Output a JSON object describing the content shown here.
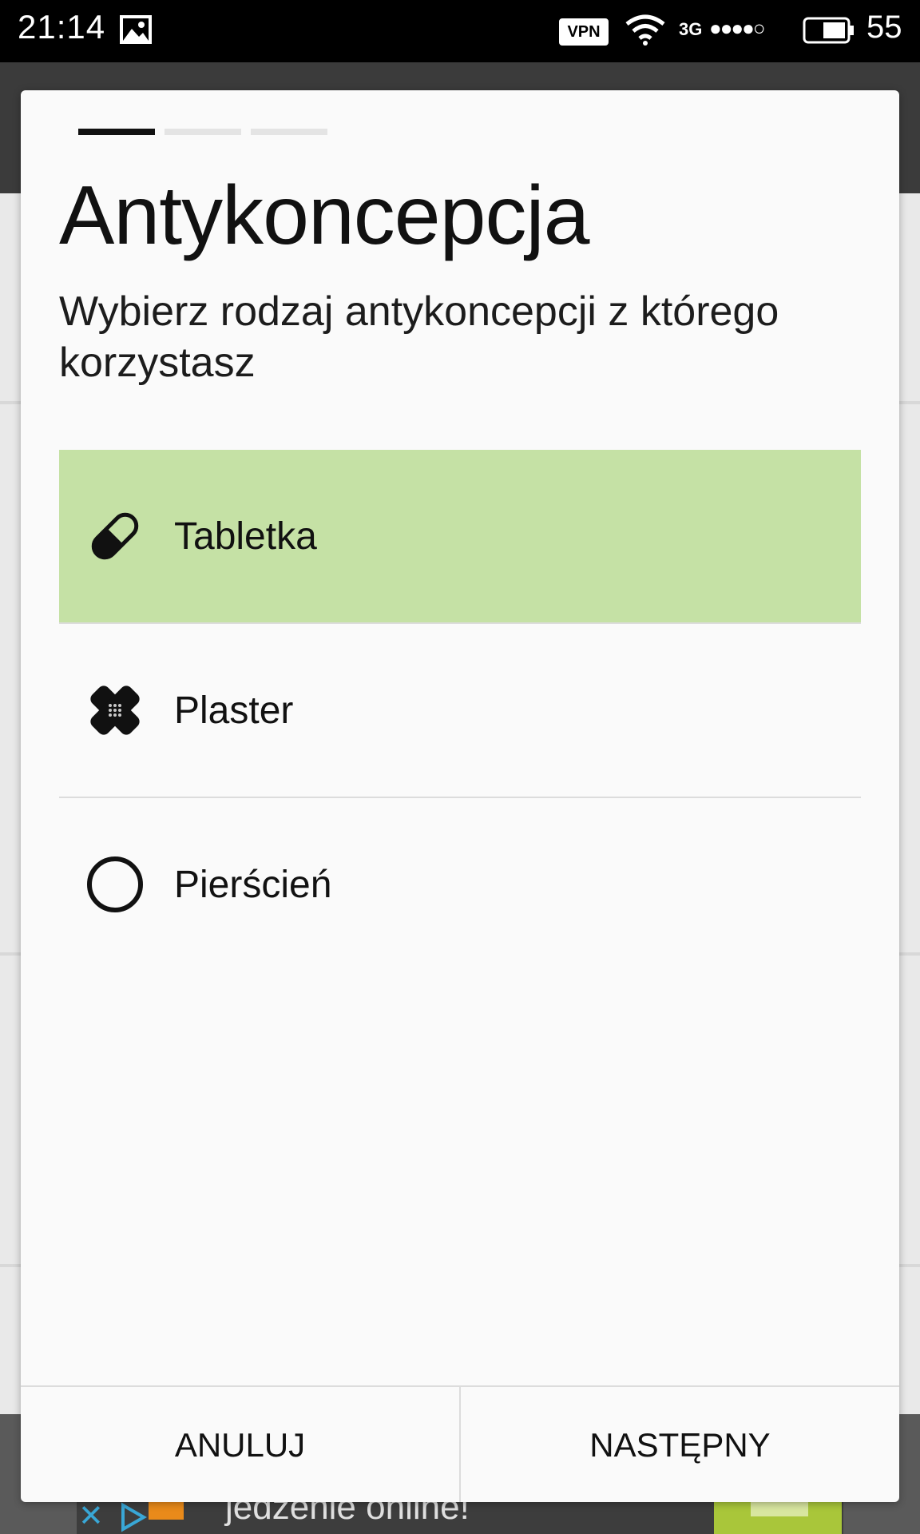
{
  "status_bar": {
    "time": "21:14",
    "vpn": "VPN",
    "network": "3G",
    "signal": "●●●●○",
    "battery": "55",
    "icons": [
      "image-icon",
      "wifi-icon",
      "battery-icon"
    ]
  },
  "dialog": {
    "progress": {
      "total_steps": 3,
      "current_step": 1
    },
    "title": "Antykoncepcja",
    "subtitle": "Wybierz rodzaj antykoncepcji z którego korzystasz",
    "selected_color": "#c5e1a5",
    "options": [
      {
        "label": "Tabletka",
        "icon": "pill-icon",
        "selected": true
      },
      {
        "label": "Plaster",
        "icon": "bandage-icon",
        "selected": false
      },
      {
        "label": "Pierścień",
        "icon": "ring-icon",
        "selected": false
      }
    ],
    "buttons": {
      "cancel": "ANULUJ",
      "next": "NASTĘPNY"
    }
  },
  "background_ad": {
    "text": "jedzenie online!"
  }
}
